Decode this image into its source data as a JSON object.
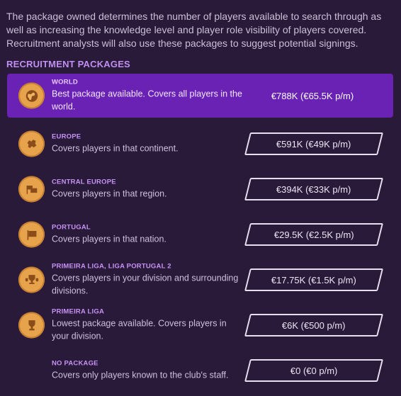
{
  "intro": "The package owned determines the number of players available to search through as well as increasing the knowledge level and player role visibility of players covered. Recruitment analysts will also use these packages to suggest potential signings.",
  "section_title": "RECRUITMENT PACKAGES",
  "packages": [
    {
      "name": "WORLD",
      "desc": "Best package available. Covers all players in the world.",
      "price": "€788K (€65.5K p/m)",
      "icon": "globe-icon"
    },
    {
      "name": "EUROPE",
      "desc": "Covers players in that continent.",
      "price": "€591K (€49K p/m)",
      "icon": "continent-icon"
    },
    {
      "name": "CENTRAL EUROPE",
      "desc": "Covers players in that region.",
      "price": "€394K (€33K p/m)",
      "icon": "region-flags-icon"
    },
    {
      "name": "PORTUGAL",
      "desc": "Covers players in that nation.",
      "price": "€29.5K (€2.5K p/m)",
      "icon": "flag-icon"
    },
    {
      "name": "PRIMEIRA LIGA, LIGA PORTUGAL 2",
      "desc": "Covers players in your division and surrounding divisions.",
      "price": "€17.75K (€1.5K p/m)",
      "icon": "trophies-icon"
    },
    {
      "name": "PRIMEIRA LIGA",
      "desc": "Lowest package available. Covers players in your division.",
      "price": "€6K (€500 p/m)",
      "icon": "trophy-icon"
    },
    {
      "name": "NO PACKAGE",
      "desc": "Covers only players known to the club's staff.",
      "price": "€0 (€0 p/m)",
      "icon": ""
    }
  ],
  "colors": {
    "selected_bg": "#6a22b4",
    "medal": "#e7a24c",
    "accent": "#c592f3"
  }
}
